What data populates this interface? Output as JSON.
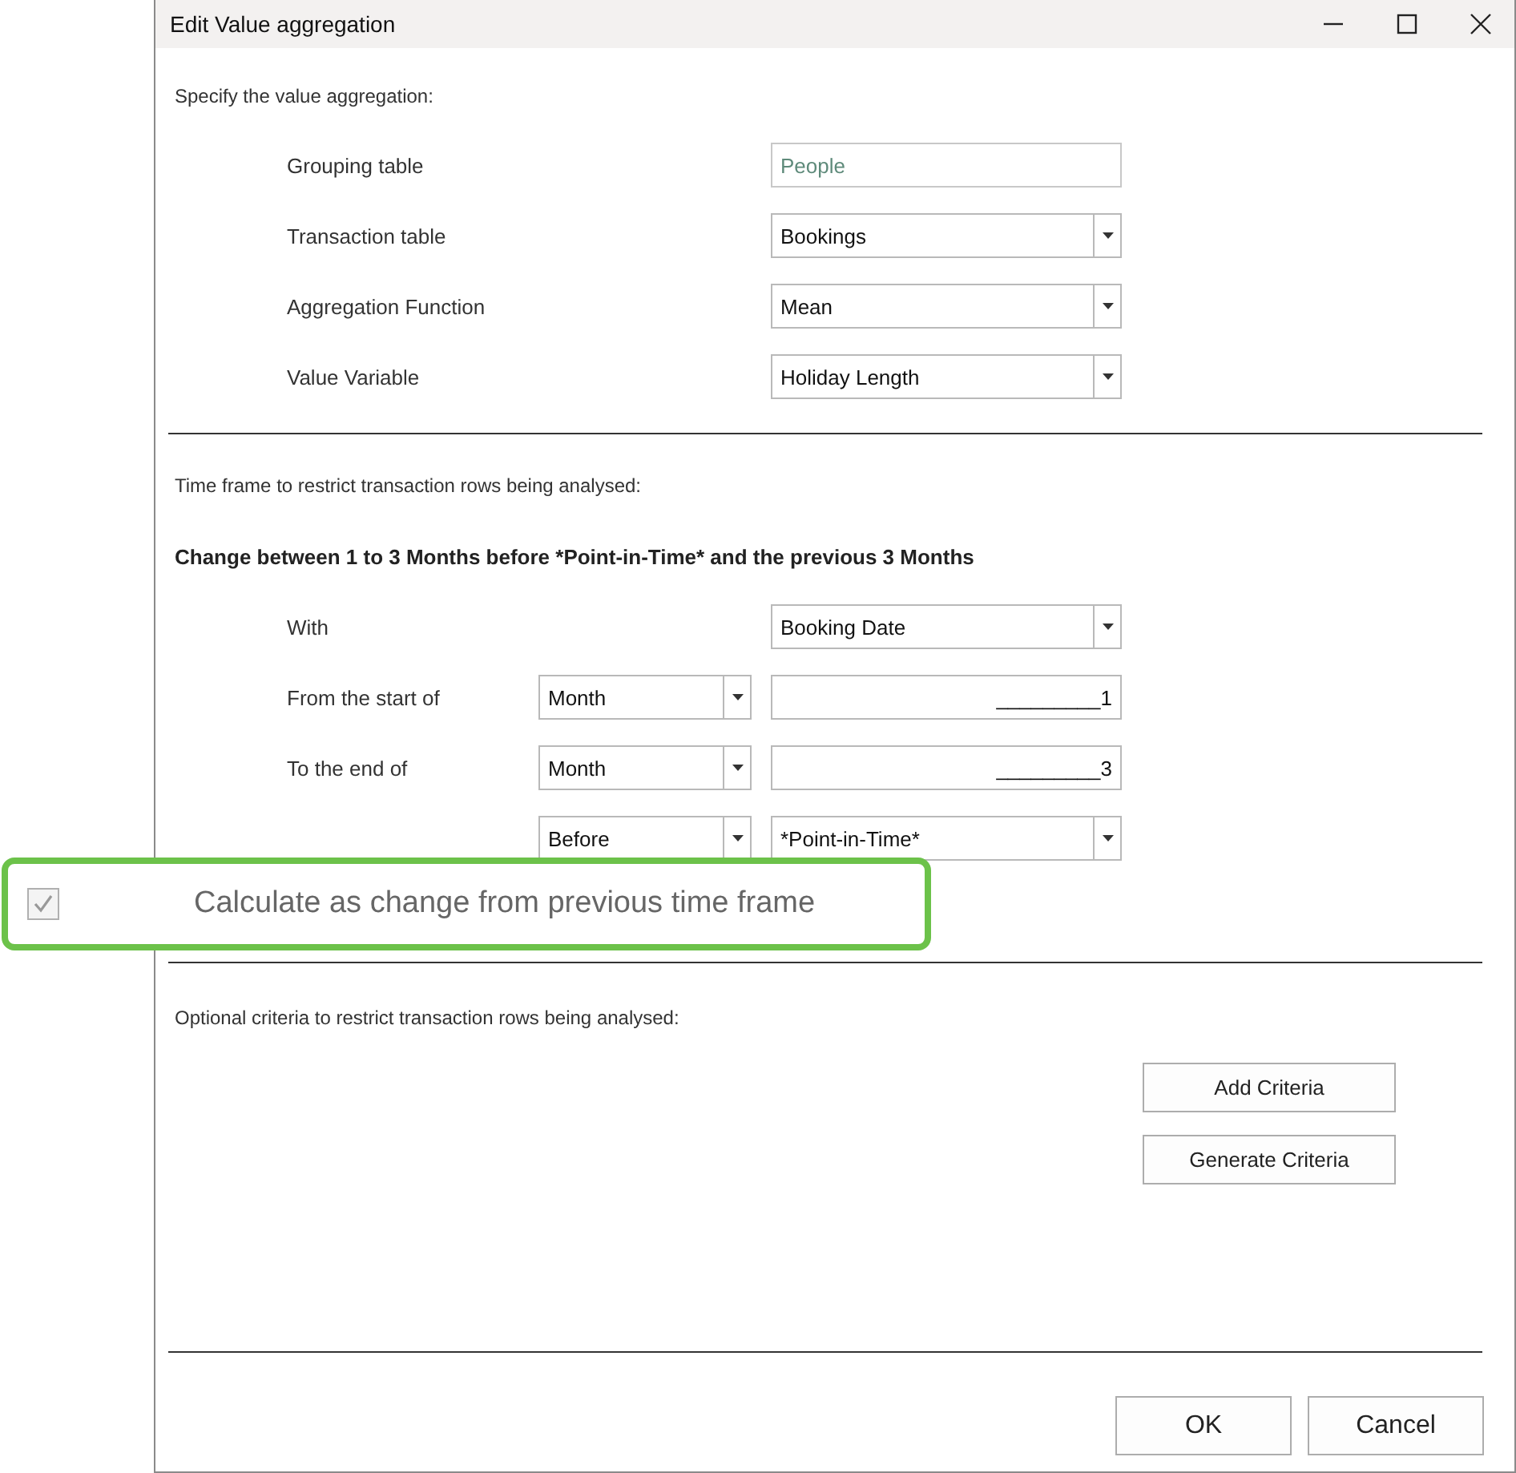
{
  "window": {
    "title": "Edit Value aggregation"
  },
  "aggregation": {
    "heading": "Specify the value aggregation:",
    "fields": [
      {
        "label": "Grouping table",
        "kind": "text",
        "value": "People",
        "disabled": true
      },
      {
        "label": "Transaction table",
        "kind": "combo",
        "value": "Bookings",
        "disabled": false
      },
      {
        "label": "Aggregation Function",
        "kind": "combo",
        "value": "Mean",
        "disabled": false
      },
      {
        "label": "Value Variable",
        "kind": "combo",
        "value": "Holiday Length",
        "disabled": false
      }
    ]
  },
  "time_frame": {
    "heading": "Time frame to restrict transaction rows being analysed:",
    "summary": "Change between 1 to 3 Months before *Point-in-Time* and the previous 3 Months",
    "rows": [
      {
        "label": "With",
        "field": {
          "kind": "combo",
          "value": "Booking Date"
        }
      },
      {
        "label": "From the start of",
        "unit": "Month",
        "field": {
          "kind": "text",
          "value": "_________1"
        }
      },
      {
        "label": "To the end of",
        "unit": "Month",
        "field": {
          "kind": "text",
          "value": "_________3"
        }
      },
      {
        "unit": "Before",
        "field": {
          "kind": "combo",
          "value": "*Point-in-Time*"
        }
      }
    ],
    "checkbox": {
      "label": "Calculate as change from previous time frame",
      "checked": true,
      "disabled": true,
      "highlighted": true
    }
  },
  "criteria": {
    "heading": "Optional criteria to restrict transaction rows being analysed:",
    "buttons": [
      "Add Criteria",
      "Generate Criteria"
    ]
  },
  "footer": {
    "buttons": [
      "OK",
      "Cancel"
    ]
  }
}
